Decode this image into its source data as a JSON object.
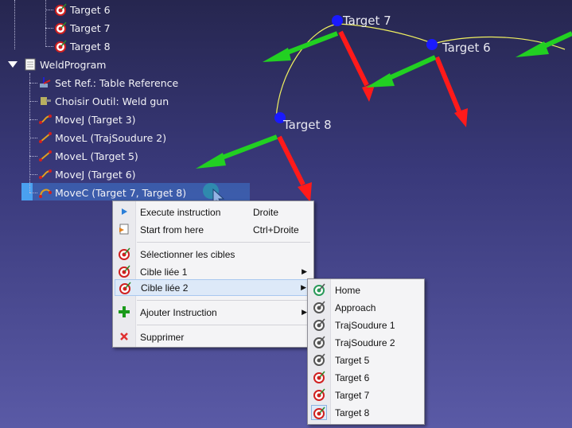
{
  "tree": {
    "items": [
      {
        "label": "Target 6",
        "icon": "target-icon"
      },
      {
        "label": "Target 7",
        "icon": "target-icon"
      },
      {
        "label": "Target 8",
        "icon": "target-icon"
      },
      {
        "label": "WeldProgram",
        "icon": "document-icon"
      },
      {
        "label": "Set Ref.: Table Reference",
        "icon": "reference-frame-icon"
      },
      {
        "label": "Choisir Outil: Weld gun",
        "icon": "weld-gun-icon"
      },
      {
        "label": "MoveJ (Target 3)",
        "icon": "movej-icon"
      },
      {
        "label": "MoveL (TrajSoudure 2)",
        "icon": "movel-icon"
      },
      {
        "label": "MoveL (Target 5)",
        "icon": "movel-icon"
      },
      {
        "label": "MoveJ (Target 6)",
        "icon": "movej-icon"
      },
      {
        "label": "MoveC (Target 7, Target 8)",
        "icon": "movec-icon"
      }
    ]
  },
  "viewport": {
    "labels": {
      "target7": "Target 7",
      "target6": "Target 6",
      "target8": "Target 8"
    },
    "colors": {
      "x_axis": "#ff1a1a",
      "y_axis": "#22d022",
      "z_axis": "#1a1aff",
      "path": "#f0f060"
    }
  },
  "context_menu": {
    "items": [
      {
        "label": "Execute instruction",
        "shortcut": "Droite",
        "icon": "play-icon"
      },
      {
        "label": "Start from here",
        "shortcut": "Ctrl+Droite",
        "icon": "start-here-icon"
      },
      {
        "label": "Sélectionner les cibles",
        "icon": "target-icon"
      },
      {
        "label": "Cible liée 1",
        "icon": "target-icon",
        "submenu": true
      },
      {
        "label": "Cible liée 2",
        "icon": "target-icon",
        "submenu": true
      },
      {
        "label": "Ajouter Instruction",
        "icon": "plus-icon",
        "submenu": true
      },
      {
        "label": "Supprimer",
        "icon": "delete-icon"
      }
    ]
  },
  "submenu": {
    "items": [
      {
        "label": "Home",
        "icon": "target-home-icon"
      },
      {
        "label": "Approach",
        "icon": "target-gray-icon"
      },
      {
        "label": "TrajSoudure 1",
        "icon": "target-gray-icon"
      },
      {
        "label": "TrajSoudure 2",
        "icon": "target-gray-icon"
      },
      {
        "label": "Target 5",
        "icon": "target-gray-icon"
      },
      {
        "label": "Target 6",
        "icon": "target-icon"
      },
      {
        "label": "Target 7",
        "icon": "target-icon"
      },
      {
        "label": "Target 8",
        "icon": "target-icon",
        "checked": true
      }
    ]
  }
}
